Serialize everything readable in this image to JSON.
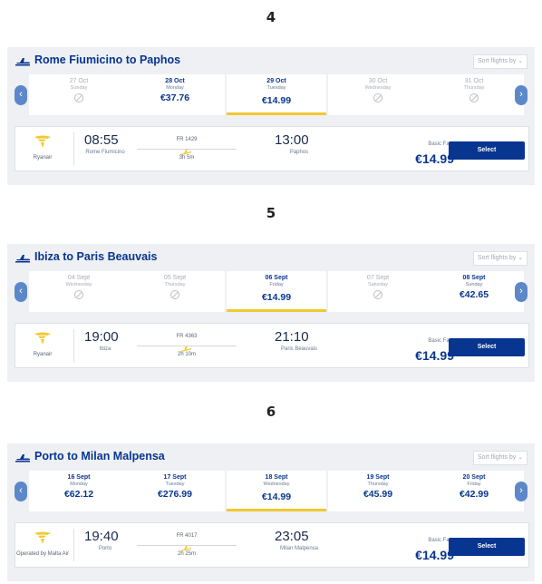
{
  "sections": [
    {
      "number": "4",
      "route": "Rome Fiumicino to Paphos",
      "sort_label": "Sort flights by ⌄",
      "dates": [
        {
          "date": "27 Oct",
          "weekday": "Sunday",
          "price": "",
          "available": false
        },
        {
          "date": "28 Oct",
          "weekday": "Monday",
          "price": "€37.76",
          "available": true
        },
        {
          "date": "29 Oct",
          "weekday": "Tuesday",
          "price": "€14.99",
          "available": true,
          "selected": true
        },
        {
          "date": "30 Oct",
          "weekday": "Wednesday",
          "price": "",
          "available": false
        },
        {
          "date": "31 Oct",
          "weekday": "Thursday",
          "price": "",
          "available": false
        }
      ],
      "flight": {
        "airline": "Ryanair",
        "departure_time": "08:55",
        "departure_city": "Rome Fiumicino",
        "flight_number": "FR 1429",
        "duration": "3h 5m",
        "arrival_time": "13:00",
        "arrival_city": "Paphos",
        "fare_label": "Basic Fare",
        "price": "€14.99",
        "select_label": "Select"
      }
    },
    {
      "number": "5",
      "route": "Ibiza to Paris Beauvais",
      "sort_label": "Sort flights by ⌄",
      "dates": [
        {
          "date": "04 Sept",
          "weekday": "Wednesday",
          "price": "",
          "available": false
        },
        {
          "date": "05 Sept",
          "weekday": "Thursday",
          "price": "",
          "available": false
        },
        {
          "date": "06 Sept",
          "weekday": "Friday",
          "price": "€14.99",
          "available": true,
          "selected": true
        },
        {
          "date": "07 Sept",
          "weekday": "Saturday",
          "price": "",
          "available": false
        },
        {
          "date": "08 Sept",
          "weekday": "Sunday",
          "price": "€42.65",
          "available": true
        }
      ],
      "flight": {
        "airline": "Ryanair",
        "departure_time": "19:00",
        "departure_city": "Ibiza",
        "flight_number": "FR 4363",
        "duration": "2h 10m",
        "arrival_time": "21:10",
        "arrival_city": "Paris Beauvais",
        "fare_label": "Basic Fare",
        "price": "€14.99",
        "select_label": "Select"
      }
    },
    {
      "number": "6",
      "route": "Porto to Milan Malpensa",
      "sort_label": "Sort flights by ⌄",
      "dates": [
        {
          "date": "16 Sept",
          "weekday": "Monday",
          "price": "€62.12",
          "available": true
        },
        {
          "date": "17 Sept",
          "weekday": "Tuesday",
          "price": "€276.99",
          "available": true
        },
        {
          "date": "18 Sept",
          "weekday": "Wednesday",
          "price": "€14.99",
          "available": true,
          "selected": true
        },
        {
          "date": "19 Sept",
          "weekday": "Thursday",
          "price": "€45.99",
          "available": true
        },
        {
          "date": "20 Sept",
          "weekday": "Friday",
          "price": "€42.99",
          "available": true
        }
      ],
      "flight": {
        "airline": "Operated by Malta Air",
        "departure_time": "19:40",
        "departure_city": "Porto",
        "flight_number": "FR 4017",
        "duration": "2h 25m",
        "arrival_time": "23:05",
        "arrival_city": "Milan Malpensa",
        "fare_label": "Basic Fare",
        "price": "€14.99",
        "select_label": "Select"
      }
    }
  ],
  "colors": {
    "brand_blue": "#073590",
    "accent_yellow": "#f1c931",
    "panel_bg": "#eef0f3",
    "nav_arrow": "#5c88c9"
  }
}
